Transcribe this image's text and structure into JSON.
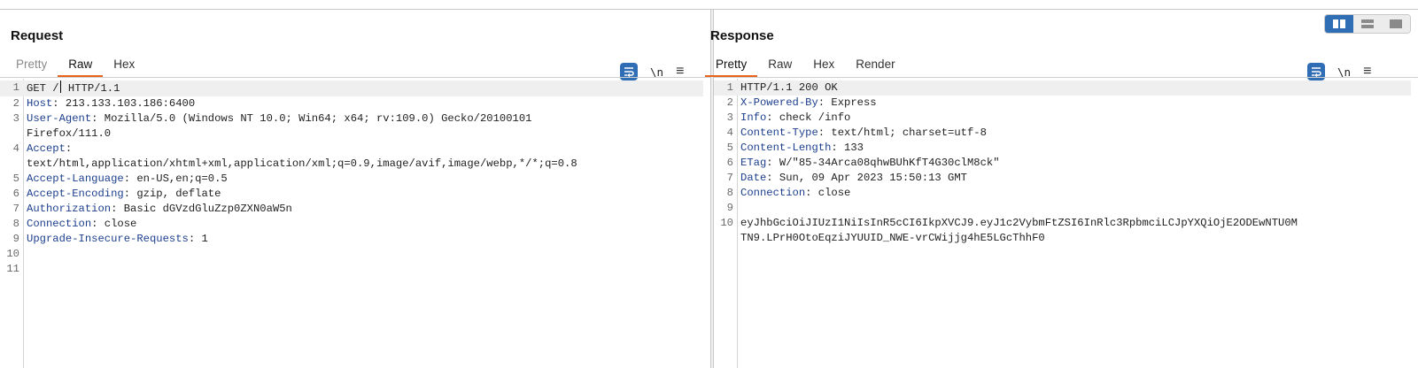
{
  "request": {
    "title": "Request",
    "tabs": [
      {
        "label": "Pretty"
      },
      {
        "label": "Raw"
      },
      {
        "label": "Hex"
      }
    ],
    "newline_toggle": "\\n",
    "lines": [
      {
        "num": "1",
        "key": "GET /",
        "value": " HTTP/1.1"
      },
      {
        "num": "2",
        "key": "Host",
        "value": ": 213.133.103.186:6400"
      },
      {
        "num": "3",
        "key": "User-Agent",
        "value": ": Mozilla/5.0 (Windows NT 10.0; Win64; x64; rv:109.0) Gecko/20100101"
      },
      {
        "num": "",
        "key": "",
        "value": "Firefox/111.0"
      },
      {
        "num": "4",
        "key": "Accept",
        "value": ":"
      },
      {
        "num": "",
        "key": "",
        "value": "text/html,application/xhtml+xml,application/xml;q=0.9,image/avif,image/webp,*/*;q=0.8"
      },
      {
        "num": "5",
        "key": "Accept-Language",
        "value": ": en-US,en;q=0.5"
      },
      {
        "num": "6",
        "key": "Accept-Encoding",
        "value": ": gzip, deflate"
      },
      {
        "num": "7",
        "key": "Authorization",
        "value": ": Basic dGVzdGluZzp0ZXN0aW5n"
      },
      {
        "num": "8",
        "key": "Connection",
        "value": ": close"
      },
      {
        "num": "9",
        "key": "Upgrade-Insecure-Requests",
        "value": ": 1"
      },
      {
        "num": "10",
        "key": "",
        "value": ""
      },
      {
        "num": "11",
        "key": "",
        "value": ""
      }
    ]
  },
  "response": {
    "title": "Response",
    "tabs": [
      {
        "label": "Pretty"
      },
      {
        "label": "Raw"
      },
      {
        "label": "Hex"
      },
      {
        "label": "Render"
      }
    ],
    "newline_toggle": "\\n",
    "lines": [
      {
        "num": "1",
        "key": "",
        "value": "HTTP/1.1 200 OK"
      },
      {
        "num": "2",
        "key": "X-Powered-By",
        "value": ": Express"
      },
      {
        "num": "3",
        "key": "Info",
        "value": ": check /info"
      },
      {
        "num": "4",
        "key": "Content-Type",
        "value": ": text/html; charset=utf-8"
      },
      {
        "num": "5",
        "key": "Content-Length",
        "value": ": 133"
      },
      {
        "num": "6",
        "key": "ETag",
        "value": ": W/\"85-34Arca08qhwBUhKfT4G30clM8ck\""
      },
      {
        "num": "7",
        "key": "Date",
        "value": ": Sun, 09 Apr 2023 15:50:13 GMT"
      },
      {
        "num": "8",
        "key": "Connection",
        "value": ": close"
      },
      {
        "num": "9",
        "key": "",
        "value": ""
      },
      {
        "num": "10",
        "key": "",
        "value": "eyJhbGciOiJIUzI1NiIsInR5cCI6IkpXVCJ9.eyJ1c2VybmFtZSI6InRlc3RpbmciLCJpYXQiOjE2ODEwNTU0M"
      },
      {
        "num": "",
        "key": "",
        "value": "TN9.LPrH0OtoEqziJYUUID_NWE-vrCWijjg4hE5LGcThhF0"
      }
    ]
  },
  "colors": {
    "accent": "#e8621c",
    "header_key": "#1d3f8e",
    "toggle_active": "#2f6db5"
  },
  "icons": [
    "wrap-lines-icon",
    "menu-icon",
    "layout-side-by-side-icon",
    "layout-stacked-icon",
    "layout-single-icon"
  ]
}
